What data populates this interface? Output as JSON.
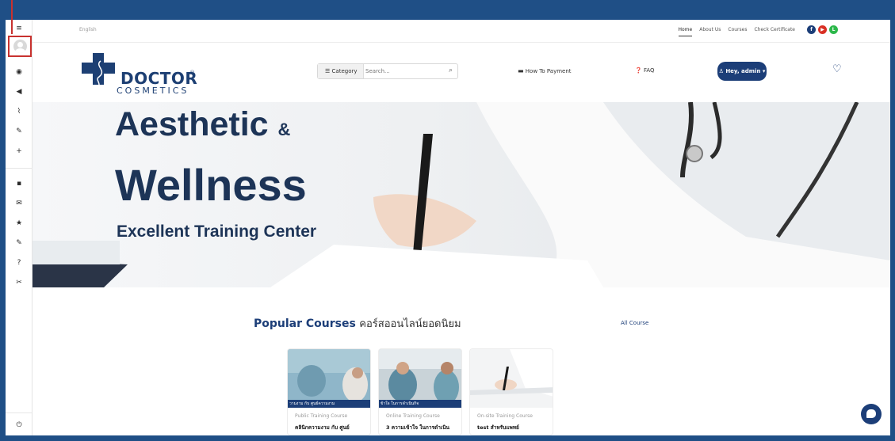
{
  "topbar": {
    "language": "English",
    "links": [
      "Home",
      "About Us",
      "Courses",
      "Check Certificate"
    ],
    "socials": [
      {
        "icon": "facebook-icon",
        "glyph": "f",
        "color": "#1c3e78"
      },
      {
        "icon": "youtube-icon",
        "glyph": "▶",
        "color": "#d93025"
      },
      {
        "icon": "line-icon",
        "glyph": "L",
        "color": "#2db84b"
      }
    ]
  },
  "header": {
    "logo_word": "DOCTOR",
    "logo_reg": "®",
    "logo_sub": "COSMETICS",
    "category_label": "Category",
    "search_placeholder": "Search...",
    "how_to_payment": "How To Payment",
    "faq": "FAQ",
    "user_button": "Hey, admin"
  },
  "hero": {
    "title_line1": "Aesthetic",
    "title_amp": "&",
    "title_line2": "Wellness",
    "subtitle": "Excellent Training Center"
  },
  "popular": {
    "title_en": "Popular Courses",
    "title_th": "คอร์สออนไลน์ยอดนิยม",
    "all_course": "All Course",
    "cards": [
      {
        "type": "Public Training Course",
        "title": "คลินิกความงาม กับ ศูนย์",
        "img_caption": "วามงาม กับ ศูนย์ความงาม"
      },
      {
        "type": "Online Training Course",
        "title": "3 ความเข้าใจ ในการดำเนิน",
        "img_caption": "ข้าใจ ในการดำเนินกิจ"
      },
      {
        "type": "On-site Training Course",
        "title": "test สำหรับแพทย์",
        "img_caption": ""
      }
    ]
  },
  "colors": {
    "brand": "#1c3e78",
    "frame": "#1f4f86",
    "highlight": "#c8322f"
  }
}
